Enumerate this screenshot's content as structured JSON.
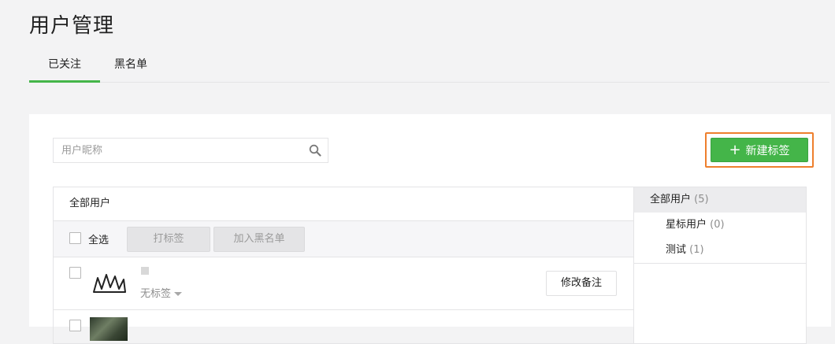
{
  "page": {
    "title": "用户管理"
  },
  "tabs": [
    {
      "label": "已关注",
      "active": true
    },
    {
      "label": "黑名单",
      "active": false
    }
  ],
  "search": {
    "placeholder": "用户昵称",
    "value": ""
  },
  "new_tag_button": {
    "label": "新建标签",
    "icon": "plus-icon",
    "highlight_color": "#ee7f2d"
  },
  "list": {
    "header": "全部用户",
    "toolbar": {
      "select_all_label": "全选",
      "tag_button_label": "打标签",
      "blacklist_button_label": "加入黑名单"
    },
    "users": [
      {
        "nickname": "",
        "tag": "无标签",
        "remark_button_label": "修改备注"
      }
    ]
  },
  "groups": [
    {
      "name": "全部用户",
      "count": "(5)",
      "active": true
    },
    {
      "name": "星标用户",
      "count": "(0)",
      "active": false
    },
    {
      "name": "测试",
      "count": "(1)",
      "active": false
    }
  ],
  "colors": {
    "accent": "#44b549",
    "background": "#f3f3f4"
  }
}
